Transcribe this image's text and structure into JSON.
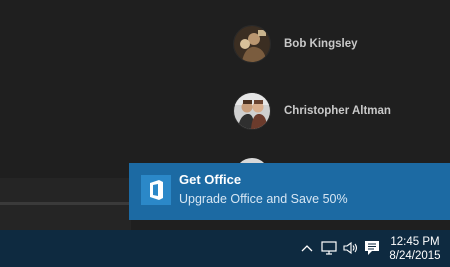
{
  "people": [
    {
      "name": "Bob Kingsley"
    },
    {
      "name": "Christopher Altman"
    }
  ],
  "toast": {
    "title": "Get Office",
    "body": "Upgrade Office and Save 50%",
    "app_icon": "office-icon"
  },
  "taskbar": {
    "tray_icons": [
      "chevron-up-icon",
      "network-icon",
      "volume-icon",
      "action-center-icon"
    ],
    "time": "12:45 PM",
    "date": "8/24/2015"
  },
  "colors": {
    "toast_background": "#1c6aa3",
    "taskbar_background": "#0e2a40",
    "window_background": "#1f1f1f"
  }
}
